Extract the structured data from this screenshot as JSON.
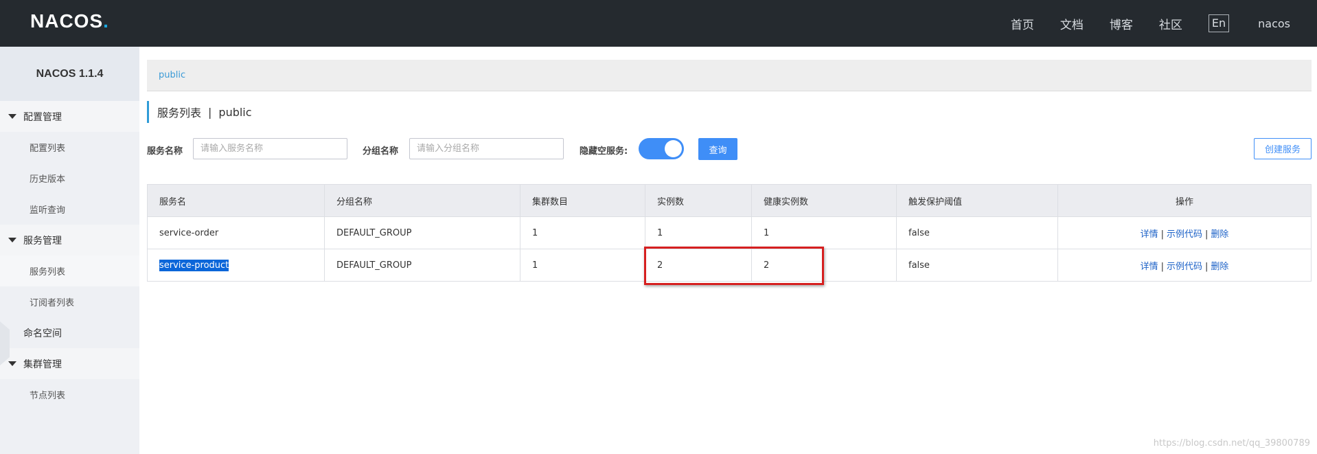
{
  "brand": {
    "logo_main": "NACOS",
    "logo_suffix": "."
  },
  "topnav": {
    "items": [
      "首页",
      "文档",
      "博客",
      "社区"
    ],
    "lang": "En",
    "user": "nacos"
  },
  "sidebar": {
    "version": "NACOS 1.1.4",
    "groups": [
      {
        "label": "配置管理",
        "items": [
          "配置列表",
          "历史版本",
          "监听查询"
        ]
      },
      {
        "label": "服务管理",
        "items": [
          "服务列表",
          "订阅者列表"
        ]
      },
      {
        "label": "命名空间"
      },
      {
        "label": "集群管理",
        "items": [
          "节点列表"
        ]
      }
    ]
  },
  "namespace_bar": {
    "label": "public"
  },
  "page_title": {
    "title": "服务列表",
    "separator": "|",
    "namespace": "public"
  },
  "filters": {
    "service_name_label": "服务名称",
    "service_name_placeholder": "请输入服务名称",
    "group_name_label": "分组名称",
    "group_name_placeholder": "请输入分组名称",
    "hide_empty_label": "隐藏空服务:",
    "hide_empty_on": true,
    "query_button": "查询",
    "create_button": "创建服务"
  },
  "table": {
    "columns": [
      "服务名",
      "分组名称",
      "集群数目",
      "实例数",
      "健康实例数",
      "触发保护阈值",
      "操作"
    ],
    "rows": [
      {
        "service": "service-order",
        "group": "DEFAULT_GROUP",
        "clusters": "1",
        "instances": "1",
        "healthy": "1",
        "threshold": "false"
      },
      {
        "service": "service-product",
        "group": "DEFAULT_GROUP",
        "clusters": "1",
        "instances": "2",
        "healthy": "2",
        "threshold": "false"
      }
    ],
    "actions": {
      "detail": "详情",
      "sample": "示例代码",
      "delete": "删除",
      "separator": "|"
    }
  },
  "watermark": "https://blog.csdn.net/qq_39800789",
  "colors": {
    "topbar": "#252a2f",
    "accent": "#3f8ef7",
    "link": "#1d62c7",
    "highlight_box": "#d61f1f"
  }
}
